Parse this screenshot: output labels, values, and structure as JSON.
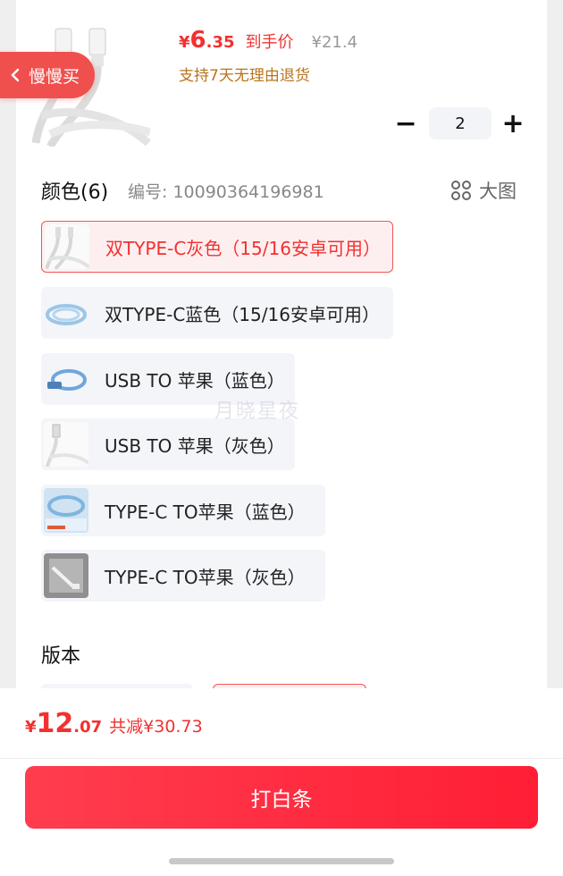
{
  "product": {
    "price_symbol": "¥",
    "price_int": "6",
    "price_dec": ".35",
    "price_label": "到手价",
    "original_price": "¥21.4",
    "return_note": "支持7天无理由退货",
    "back_label": "慢慢买"
  },
  "quantity": {
    "minus": "−",
    "value": "2",
    "plus": "+"
  },
  "color_section": {
    "title": "颜色(6)",
    "code": "编号: 10090364196981",
    "big_pic_label": "大图",
    "options": [
      {
        "label": "双TYPE-C灰色（15/16安卓可用）",
        "selected": true
      },
      {
        "label": "双TYPE-C蓝色（15/16安卓可用）",
        "selected": false
      },
      {
        "label": "USB TO 苹果（蓝色）",
        "selected": false
      },
      {
        "label": "USB TO 苹果（灰色）",
        "selected": false
      },
      {
        "label": "TYPE-C TO苹果（蓝色）",
        "selected": false
      },
      {
        "label": "TYPE-C TO苹果（灰色）",
        "selected": false
      }
    ]
  },
  "version_section": {
    "title": "版本"
  },
  "watermark": "月晓星夜",
  "bottom_bar": {
    "total_symbol": "¥",
    "total_int": "12",
    "total_dec": ".07",
    "savings": "共减¥30.73",
    "buy_label": "打白条"
  },
  "colors": {
    "accent": "#f2312f",
    "orange_note": "#b9741e",
    "pill": "#f0504d"
  }
}
